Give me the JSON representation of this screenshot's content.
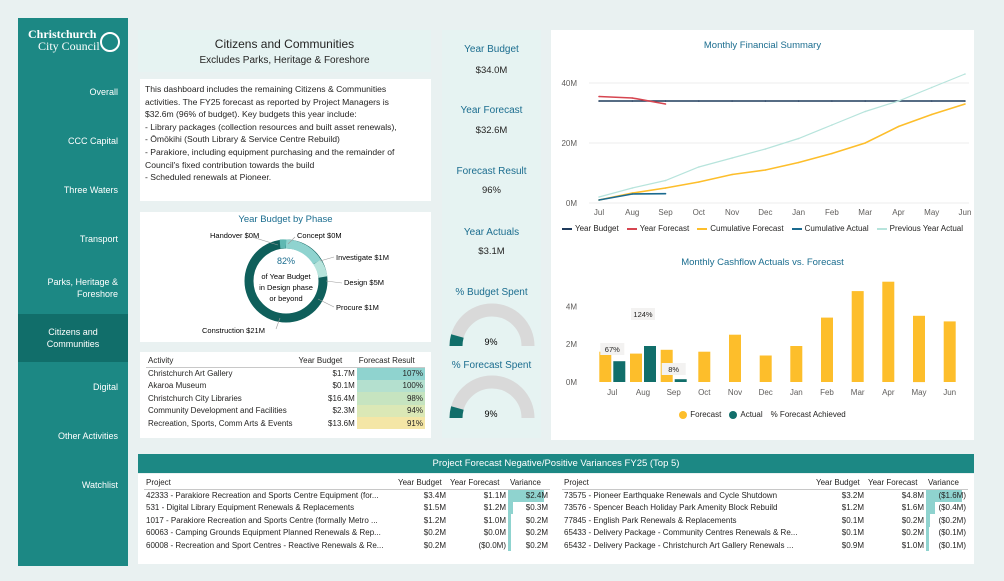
{
  "brand": {
    "line1": "Christchurch",
    "line2": "City Council"
  },
  "nav": [
    {
      "label": "Overall"
    },
    {
      "label": "CCC Capital"
    },
    {
      "label": "Three Waters"
    },
    {
      "label": "Transport"
    },
    {
      "label": "Parks, Heritage & Foreshore"
    },
    {
      "label": "Citizens and Communities",
      "active": true
    },
    {
      "label": "Digital"
    },
    {
      "label": "Other Activities"
    },
    {
      "label": "Watchlist"
    }
  ],
  "header": {
    "title": "Citizens and Communities",
    "subtitle": "Excludes Parks, Heritage & Foreshore"
  },
  "intro_lines": [
    "This dashboard includes the remaining Citizens & Communities",
    "activities.  The FY25 forecast as reported by Project Managers is",
    "$32.6m (96% of budget).  Key budgets this year include:",
    "- Library packages (collection resources and built asset renewals),",
    "- Ōmōkihi (South Library & Service Centre Rebuild)",
    "- Parakiore, including equipment purchasing and the remainder of",
    "Council's fixed contribution towards the build",
    "- Scheduled renewals at Pioneer."
  ],
  "kpis": {
    "year_budget_label": "Year Budget",
    "year_budget_value": "$34.0M",
    "year_forecast_label": "Year Forecast",
    "year_forecast_value": "$32.6M",
    "forecast_result_label": "Forecast Result",
    "forecast_result_value": "96%",
    "year_actuals_label": "Year Actuals",
    "year_actuals_value": "$3.1M",
    "budget_spent_label": "% Budget Spent",
    "budget_spent_value": "9%",
    "budget_spent_fraction": 0.09,
    "forecast_spent_label": "% Forecast Spent",
    "forecast_spent_value": "9%",
    "forecast_spent_fraction": 0.09
  },
  "phase": {
    "title": "Year Budget by Phase",
    "center_pct": "82%",
    "center_lines": [
      "of Year Budget",
      "in Design phase",
      "or beyond"
    ],
    "labels": [
      "Handover $0M",
      "Concept $0M",
      "Investigate $1M",
      "Design $5M",
      "Procure $1M",
      "Construction $21M"
    ]
  },
  "activity_table": {
    "headers": [
      "Activity",
      "Year Budget",
      "Forecast Result"
    ],
    "rows": [
      {
        "activity": "Christchurch Art Gallery",
        "budget": "$1.7M",
        "result": "107%",
        "color": "#8fd3cf"
      },
      {
        "activity": "Akaroa Museum",
        "budget": "$0.1M",
        "result": "100%",
        "color": "#b4e0cf"
      },
      {
        "activity": "Christchurch City Libraries",
        "budget": "$16.4M",
        "result": "98%",
        "color": "#c6e4c0"
      },
      {
        "activity": "Community Development and Facilities",
        "budget": "$2.3M",
        "result": "94%",
        "color": "#dbe8b6"
      },
      {
        "activity": "Recreation, Sports, Comm Arts & Events",
        "budget": "$13.6M",
        "result": "91%",
        "color": "#f4e6a6"
      }
    ]
  },
  "monthly_summary": {
    "title": "Monthly Financial Summary",
    "legend": [
      "Year Budget",
      "Year Forecast",
      "Cumulative Forecast",
      "Cumulative Actual",
      "Previous Year Actual"
    ],
    "colors": [
      "#1f3b5c",
      "#d64550",
      "#fdbe2b",
      "#1b6a8f",
      "#b7e4dc"
    ]
  },
  "cashflow": {
    "title": "Monthly Cashflow Actuals vs. Forecast",
    "legend": [
      "Forecast",
      "Actual",
      "% Forecast Achieved"
    ],
    "colors": [
      "#fdbe2b",
      "#116e6a"
    ],
    "annotations": [
      "67%",
      "124%",
      "8%"
    ]
  },
  "banner": {
    "title": "Project Forecast Negative/Positive Variances FY25 (Top 5)"
  },
  "variance_headers": [
    "Project",
    "Year Budget",
    "Year Forecast",
    "Variance"
  ],
  "variance_left": [
    {
      "project": "42333 - Parakiore Recreation and Sports Centre Equipment (for...",
      "budget": "$3.4M",
      "forecast": "$1.1M",
      "variance": "$2.4M",
      "bar": 1.0
    },
    {
      "project": "531 - Digital Library Equipment Renewals & Replacements",
      "budget": "$1.5M",
      "forecast": "$1.2M",
      "variance": "$0.3M",
      "bar": 0.13
    },
    {
      "project": "1017 - Parakiore Recreation and Sports Centre (formally Metro ...",
      "budget": "$1.2M",
      "forecast": "$1.0M",
      "variance": "$0.2M",
      "bar": 0.09
    },
    {
      "project": "60063 - Camping Grounds Equipment Planned Renewals & Rep...",
      "budget": "$0.2M",
      "forecast": "$0.0M",
      "variance": "$0.2M",
      "bar": 0.08
    },
    {
      "project": "60008 - Recreation and Sport Centres - Reactive Renewals & Re...",
      "budget": "$0.2M",
      "forecast": "($0.0M)",
      "variance": "$0.2M",
      "bar": 0.08
    }
  ],
  "variance_right": [
    {
      "project": "73575 - Pioneer Earthquake Renewals and Cycle Shutdown",
      "budget": "$3.2M",
      "forecast": "$4.8M",
      "variance": "($1.6M)",
      "bar": 1.0
    },
    {
      "project": "73576 - Spencer Beach Holiday Park Amenity Block Rebuild",
      "budget": "$1.2M",
      "forecast": "$1.6M",
      "variance": "($0.4M)",
      "bar": 0.25
    },
    {
      "project": "77845 - English Park Renewals & Replacements",
      "budget": "$0.1M",
      "forecast": "$0.2M",
      "variance": "($0.2M)",
      "bar": 0.11
    },
    {
      "project": "65433 - Delivery Package - Community Centres Renewals & Re...",
      "budget": "$0.1M",
      "forecast": "$0.2M",
      "variance": "($0.1M)",
      "bar": 0.08
    },
    {
      "project": "65432 - Delivery Package - Christchurch Art Gallery Renewals ...",
      "budget": "$0.9M",
      "forecast": "$1.0M",
      "variance": "($0.1M)",
      "bar": 0.07
    }
  ],
  "chart_data": [
    {
      "type": "line",
      "title": "Monthly Financial Summary",
      "categories": [
        "Jul",
        "Aug",
        "Sep",
        "Oct",
        "Nov",
        "Dec",
        "Jan",
        "Feb",
        "Mar",
        "Apr",
        "May",
        "Jun"
      ],
      "yticks": [
        "0M",
        "20M",
        "40M"
      ],
      "ylim": [
        0,
        42
      ],
      "series": [
        {
          "name": "Year Budget",
          "values": [
            34,
            34,
            34,
            34,
            34,
            34,
            34,
            34,
            34,
            34,
            34,
            34
          ]
        },
        {
          "name": "Year Forecast",
          "values": [
            35.5,
            35,
            33,
            null,
            null,
            null,
            null,
            null,
            null,
            null,
            null,
            null
          ]
        },
        {
          "name": "Cumulative Forecast",
          "values": [
            1,
            3.3,
            5,
            7,
            9.5,
            11,
            13.5,
            16.5,
            20,
            25.5,
            29.5,
            33
          ]
        },
        {
          "name": "Cumulative Actual",
          "values": [
            1,
            3,
            3.1,
            null,
            null,
            null,
            null,
            null,
            null,
            null,
            null,
            null
          ]
        },
        {
          "name": "Previous Year Actual",
          "values": [
            2,
            5,
            7.5,
            12,
            15,
            18,
            21.5,
            26,
            30.5,
            34,
            38.5,
            43
          ]
        }
      ]
    },
    {
      "type": "bar",
      "title": "Monthly Cashflow Actuals vs. Forecast",
      "categories": [
        "Jul",
        "Aug",
        "Sep",
        "Oct",
        "Nov",
        "Dec",
        "Jan",
        "Feb",
        "Mar",
        "Apr",
        "May",
        "Jun"
      ],
      "yticks": [
        "0M",
        "2M",
        "4M"
      ],
      "ylim": [
        0,
        5.6
      ],
      "series": [
        {
          "name": "Forecast",
          "values": [
            1.6,
            1.5,
            1.7,
            1.6,
            2.5,
            1.4,
            1.9,
            3.4,
            4.8,
            5.3,
            3.5,
            3.2
          ]
        },
        {
          "name": "Actual",
          "values": [
            1.1,
            1.9,
            0.15,
            null,
            null,
            null,
            null,
            null,
            null,
            null,
            null,
            null
          ]
        }
      ]
    }
  ]
}
